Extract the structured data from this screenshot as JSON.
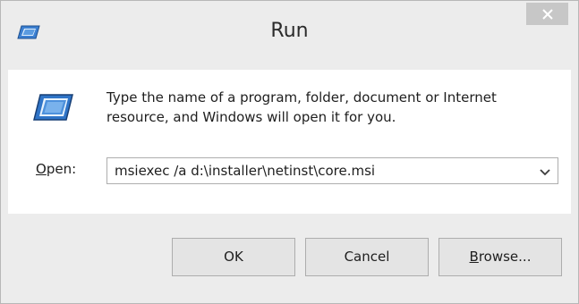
{
  "window": {
    "title": "Run"
  },
  "description": "Type the name of a program, folder, document or Internet resource, and Windows will open it for you.",
  "open": {
    "label_accel": "O",
    "label_rest": "pen:",
    "value": "msiexec /a d:\\installer\\netinst\\core.msi"
  },
  "buttons": {
    "ok": "OK",
    "cancel": "Cancel",
    "browse_accel": "B",
    "browse_rest": "rowse..."
  },
  "icons": {
    "title": "run-app-icon",
    "main": "run-dialog-icon",
    "close": "close-icon",
    "dropdown": "chevron-down-icon"
  },
  "colors": {
    "chrome": "#ececec",
    "close_bg": "#c7c7c7",
    "icon_blue": "#1f5fa8"
  }
}
